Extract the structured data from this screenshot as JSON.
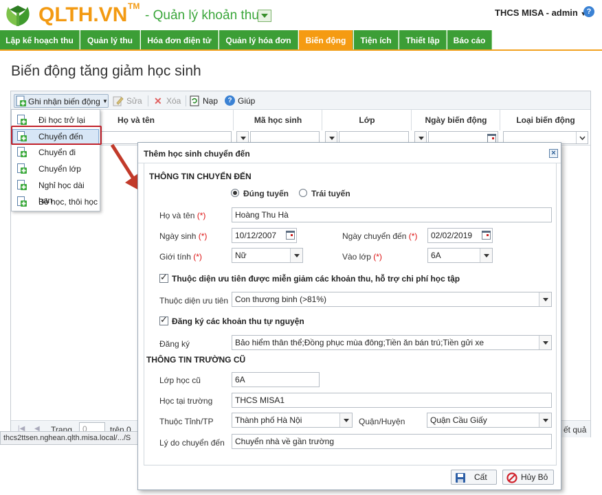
{
  "header": {
    "logo": "QLTH.VN",
    "logo_tm": "TM",
    "subtitle": "- Quản lý khoản thu",
    "user": "THCS MISA - admin",
    "help": "?"
  },
  "nav": [
    {
      "label": "Lập kế hoạch thu",
      "active": false
    },
    {
      "label": "Quản lý thu",
      "active": false
    },
    {
      "label": "Hóa đơn điện tử",
      "active": false
    },
    {
      "label": "Quản lý hóa đơn",
      "active": false
    },
    {
      "label": "Biến động",
      "active": true
    },
    {
      "label": "Tiện ích",
      "active": false
    },
    {
      "label": "Thiết lập",
      "active": false
    },
    {
      "label": "Báo cáo",
      "active": false
    }
  ],
  "page_title": "Biến động tăng giảm học sinh",
  "toolbar": {
    "record": "Ghi nhận biến động",
    "edit": "Sửa",
    "delete": "Xóa",
    "reload": "Nạp",
    "help": "Giúp"
  },
  "columns": [
    "Họ và tên",
    "Mã học sinh",
    "Lớp",
    "Ngày biến động",
    "Loại biến động"
  ],
  "pager": {
    "page_label": "Trang",
    "page_value": "0",
    "of_label": "trên 0",
    "result_text": "ết quả"
  },
  "status_url": "thcs2ttsen.nghean.qlth.misa.local/.../S",
  "menu": [
    "Đi học trở lại",
    "Chuyển đến",
    "Chuyển đi",
    "Chuyển lớp",
    "Nghỉ học dài hạn",
    "Bỏ học, thôi học"
  ],
  "dialog": {
    "title": "Thêm học sinh chuyển đến",
    "section1": "THÔNG TIN CHUYỂN ĐẾN",
    "radio_pass": "Đúng tuyến",
    "radio_fail": "Trái tuyến",
    "full_name_label": "Họ và tên",
    "full_name": "Hoàng Thu Hà",
    "dob_label": "Ngày sinh",
    "dob": "10/12/2007",
    "transfer_date_label": "Ngày chuyển đến",
    "transfer_date": "02/02/2019",
    "gender_label": "Giới tính",
    "gender": "Nữ",
    "class_label": "Vào lớp",
    "class": "6A",
    "priority_check": "Thuộc diện ưu tiên được miễn giảm các khoản thu, hỗ trợ chi phí học tập",
    "priority_label": "Thuộc diện ưu tiên",
    "priority_value": "Con thương binh (>81%)",
    "voluntary_check": "Đăng ký các khoản thu tự nguyện",
    "register_label": "Đăng ký",
    "register_value": "Bảo hiểm thân thể;Đồng phục mùa đông;Tiền ăn bán trú;Tiền gửi xe",
    "section2": "THÔNG TIN TRƯỜNG CŨ",
    "old_class_label": "Lớp học cũ",
    "old_class": "6A",
    "old_school_label": "Học tại trường",
    "old_school": "THCS MISA1",
    "province_label": "Thuộc Tỉnh/TP",
    "province": "Thành phố Hà Nội",
    "district_label": "Quận/Huyện",
    "district": "Quận Cầu Giấy",
    "reason_label": "Lý do chuyển đến",
    "reason": "Chuyển nhà về gần trường",
    "required_mark": "(*)",
    "save": "Cất",
    "cancel": "Hủy Bỏ"
  }
}
